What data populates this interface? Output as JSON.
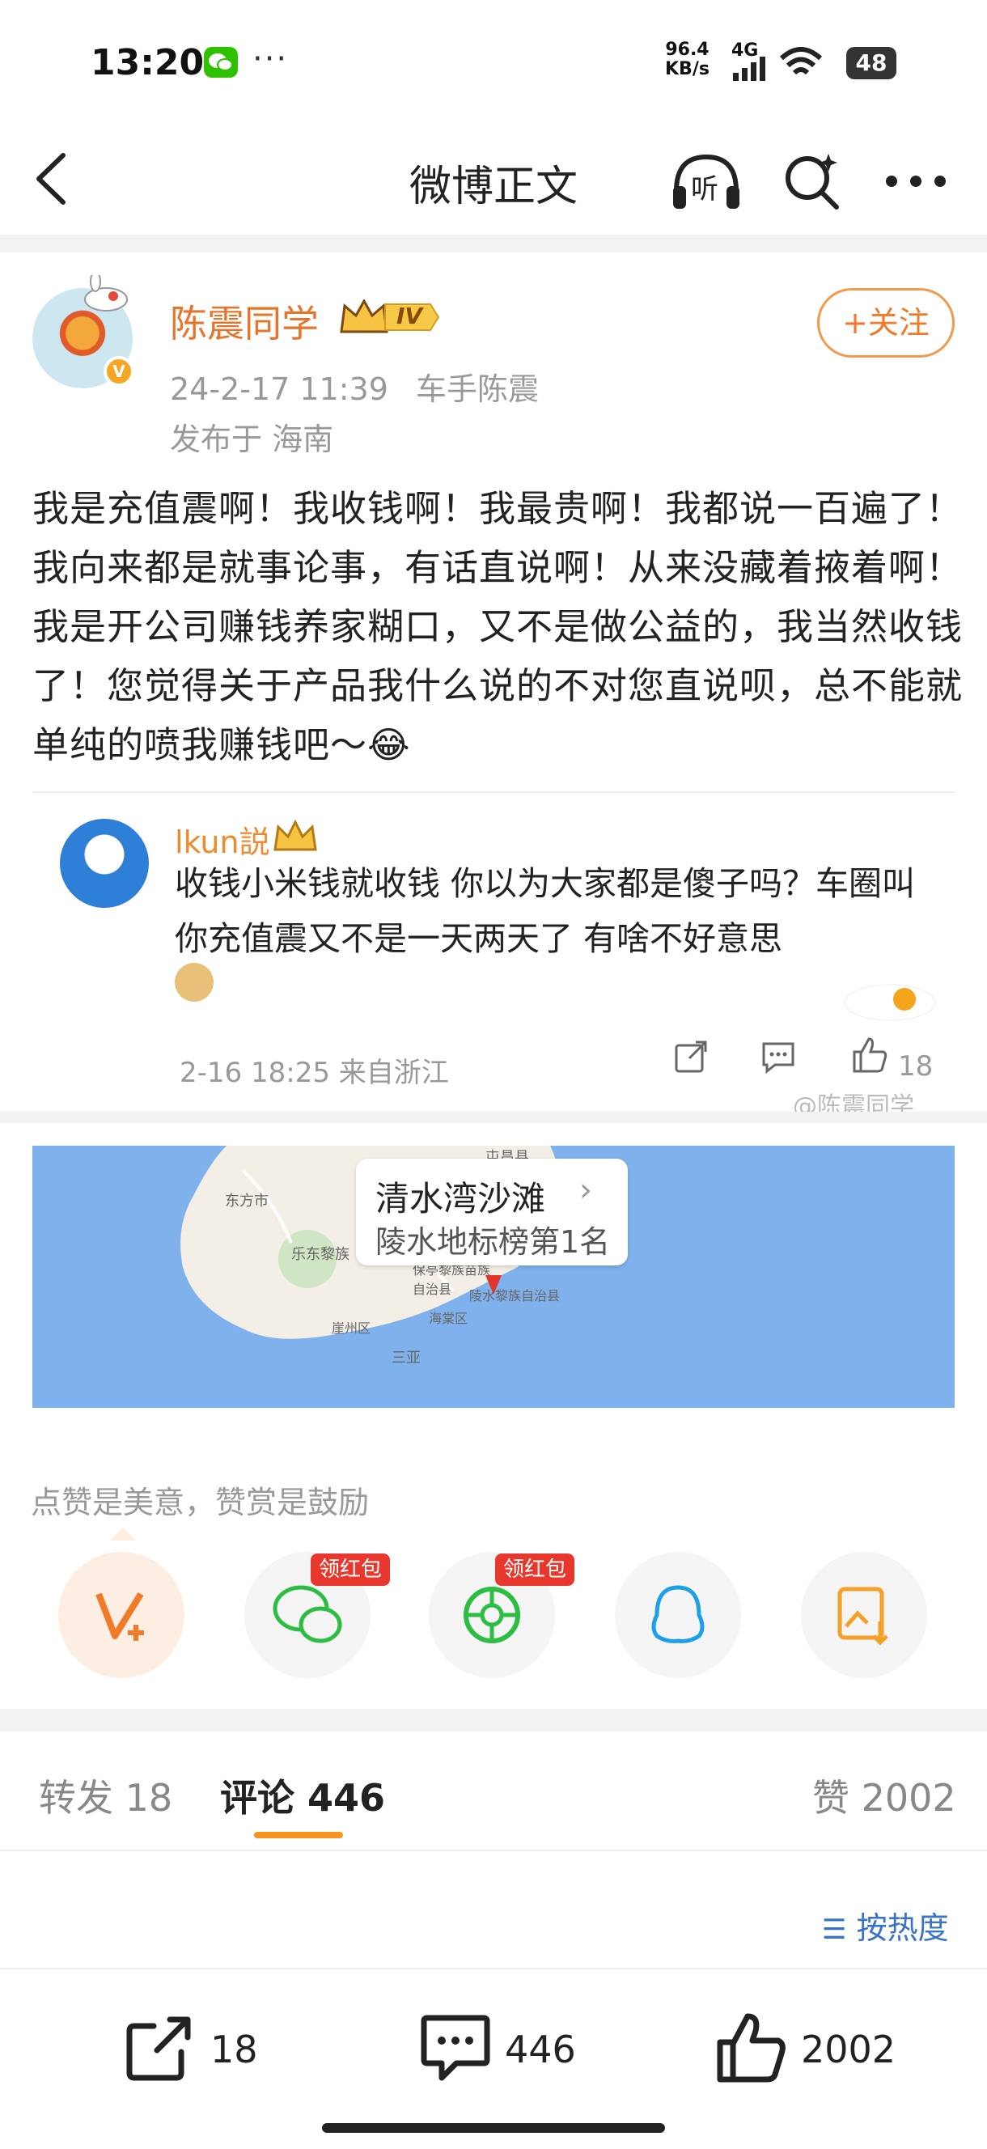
{
  "status_bar": {
    "time": "13:20",
    "dots": "···",
    "net_speed_value": "96.4",
    "net_speed_unit": "KB/s",
    "network": "4G",
    "battery": "48"
  },
  "nav": {
    "title": "微博正文",
    "icons": [
      "back-icon",
      "listen-icon",
      "search-icon",
      "more-icon"
    ],
    "listen_label": "听"
  },
  "post": {
    "username": "陈震同学",
    "level_badge": "IV",
    "follow_label": "+关注",
    "date": "24-2-17 11:39",
    "source": "车手陈震",
    "location": "发布于 海南",
    "text": "我是充值震啊！我收钱啊！我最贵啊！我都说一百遍了！我向来都是就事论事，有话直说啊！从来没藏着掖着啊！我是开公司赚钱养家糊口，又不是做公益的，我当然收钱了！您觉得关于产品我什么说的不对您直说呗，总不能就单纯的喷我赚钱吧～😂"
  },
  "quoted_comment": {
    "username": "lkun説",
    "text": "收钱小米钱就收钱 你以为大家都是傻子吗？车圈叫你充值震又不是一天两天了 有啥不好意思",
    "meta": "2-16 18:25 来自浙江",
    "likes": "18",
    "watermark": "@陈震同学"
  },
  "map": {
    "place": "清水湾沙滩",
    "rank": "陵水地标榜第1名",
    "labels": [
      "屯昌县",
      "东方市",
      "乐东黎族",
      "保亭黎族苗族自治县",
      "陵水黎族自治县",
      "海棠区",
      "崖州区",
      "三亚"
    ]
  },
  "reward": {
    "label": "点赞是美意，赞赏是鼓励",
    "items": [
      {
        "name": "vplus",
        "badge": ""
      },
      {
        "name": "wechat",
        "badge": "领红包"
      },
      {
        "name": "moments",
        "badge": "领红包"
      },
      {
        "name": "qq",
        "badge": ""
      },
      {
        "name": "save-image",
        "badge": ""
      }
    ]
  },
  "tabs": {
    "repost": "转发 18",
    "comments": "评论 446",
    "likes": "赞 2002"
  },
  "sort": "按热度",
  "toolbar": {
    "repost": "18",
    "comment": "446",
    "like": "2002"
  },
  "colors": {
    "accent_orange": "#f07a28",
    "link_blue": "#3a72c8",
    "sea": "#7fb2ec",
    "land": "#f3efe6"
  }
}
